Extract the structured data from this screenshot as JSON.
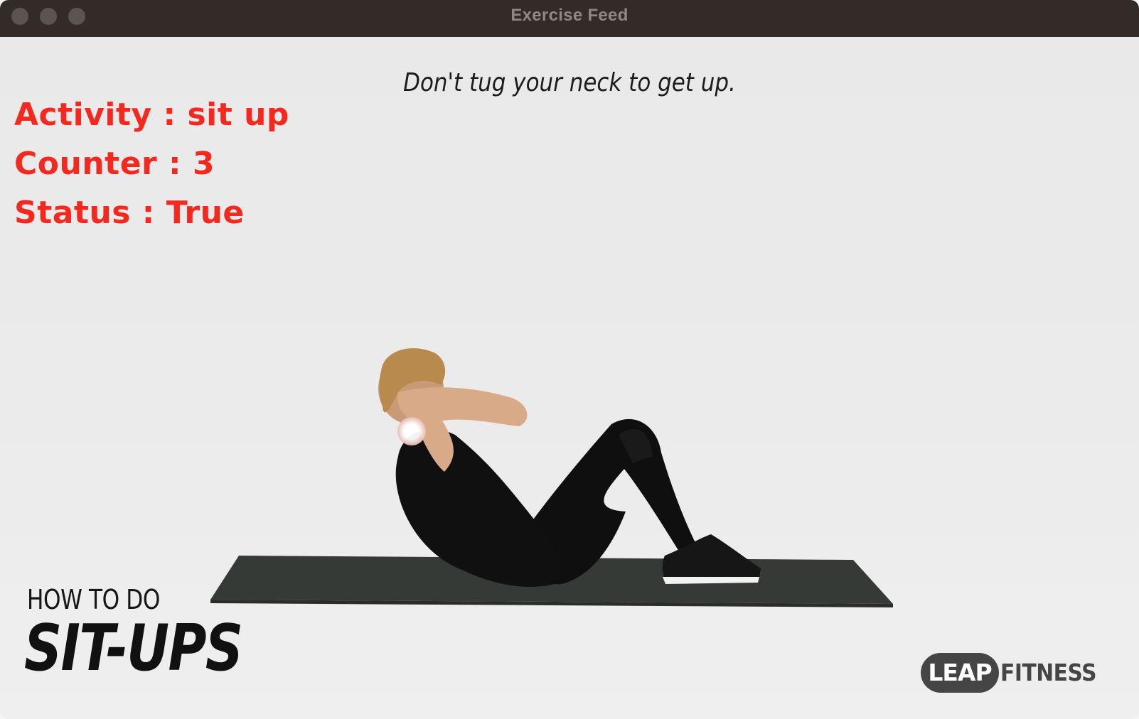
{
  "window": {
    "title": "Exercise Feed"
  },
  "feed": {
    "caption": "Don't tug your neck to get up.",
    "overlay": {
      "activity": "Activity : sit up",
      "counter": "Counter : 3",
      "status": "Status : True",
      "color": "#f3281f"
    },
    "video_title": {
      "line1": "HOW TO DO",
      "line2": "SIT-UPS"
    },
    "logo": {
      "badge": "LEAP",
      "text": "FITNESS"
    }
  }
}
